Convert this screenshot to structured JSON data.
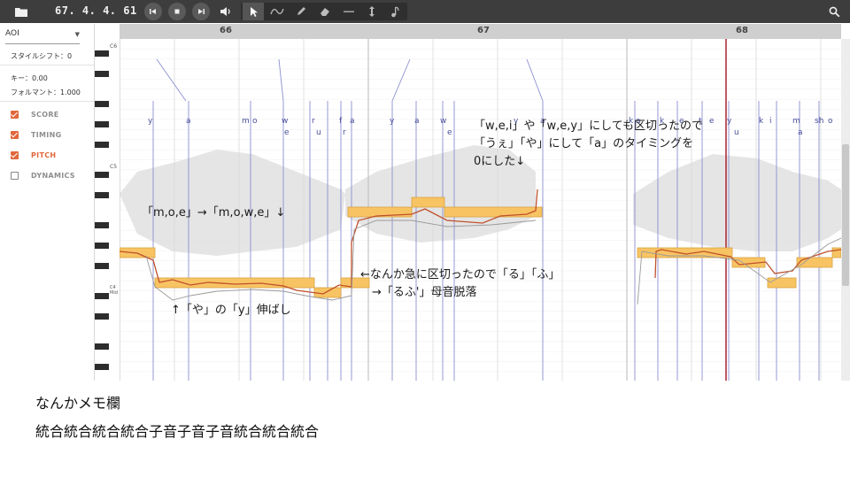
{
  "toolbar": {
    "position": "67. 4. 4. 61",
    "icons": [
      "folder-icon",
      "skip-back-icon",
      "stop-icon",
      "skip-forward-icon",
      "volume-icon",
      "pointer-icon",
      "curve-icon",
      "pencil-icon",
      "eraser-icon",
      "line-icon",
      "vertical-arrows-icon",
      "note-icon",
      "search-icon"
    ]
  },
  "panel": {
    "voice": "AOI",
    "style_shift": "スタイルシフト：0",
    "key": "キー：0.00",
    "formant": "フォルマント：1.000",
    "checks": [
      {
        "label": "SCORE",
        "checked": true
      },
      {
        "label": "TIMING",
        "checked": true
      },
      {
        "label": "PITCH",
        "checked": true
      },
      {
        "label": "DYNAMICS",
        "checked": false
      }
    ]
  },
  "editor": {
    "bars": [
      "66",
      "67",
      "68"
    ],
    "key_labels": [
      "C6",
      "C5",
      "C4 Mid"
    ],
    "lyrics_row1": [
      "y",
      "a",
      "m",
      "o",
      "w",
      "r",
      "f",
      "a",
      "y",
      "a",
      "w",
      "y",
      "a",
      "k",
      "a",
      "k",
      "e",
      "t",
      "e",
      "y",
      "k",
      "i",
      "m",
      "sh",
      "o"
    ],
    "lyrics_row2": [
      "e",
      "u",
      "r",
      "e",
      "u",
      "a"
    ]
  },
  "annotations": {
    "a1": "「w,e,i」や「w,e,y」にしても区切ったので\n「うぇ」「や」にして「a」のタイミングを\n0にした↓",
    "a2": "「m,o,e」→「m,o,w,e」↓",
    "a3": "←なんか急に区切ったので「る」「ふ」\n　→「るふ'」母音脱落",
    "a4": "↑「や」の「y」伸ばし"
  },
  "memo": {
    "title": "なんかメモ欄",
    "body": "統合統合統合統合子音子音子音統合統合統合"
  },
  "colors": {
    "toolbar_bg": "#3d3d3d",
    "accent": "#e0683c",
    "note_fill": "#f8c463",
    "pitch_line": "#c0502c"
  }
}
